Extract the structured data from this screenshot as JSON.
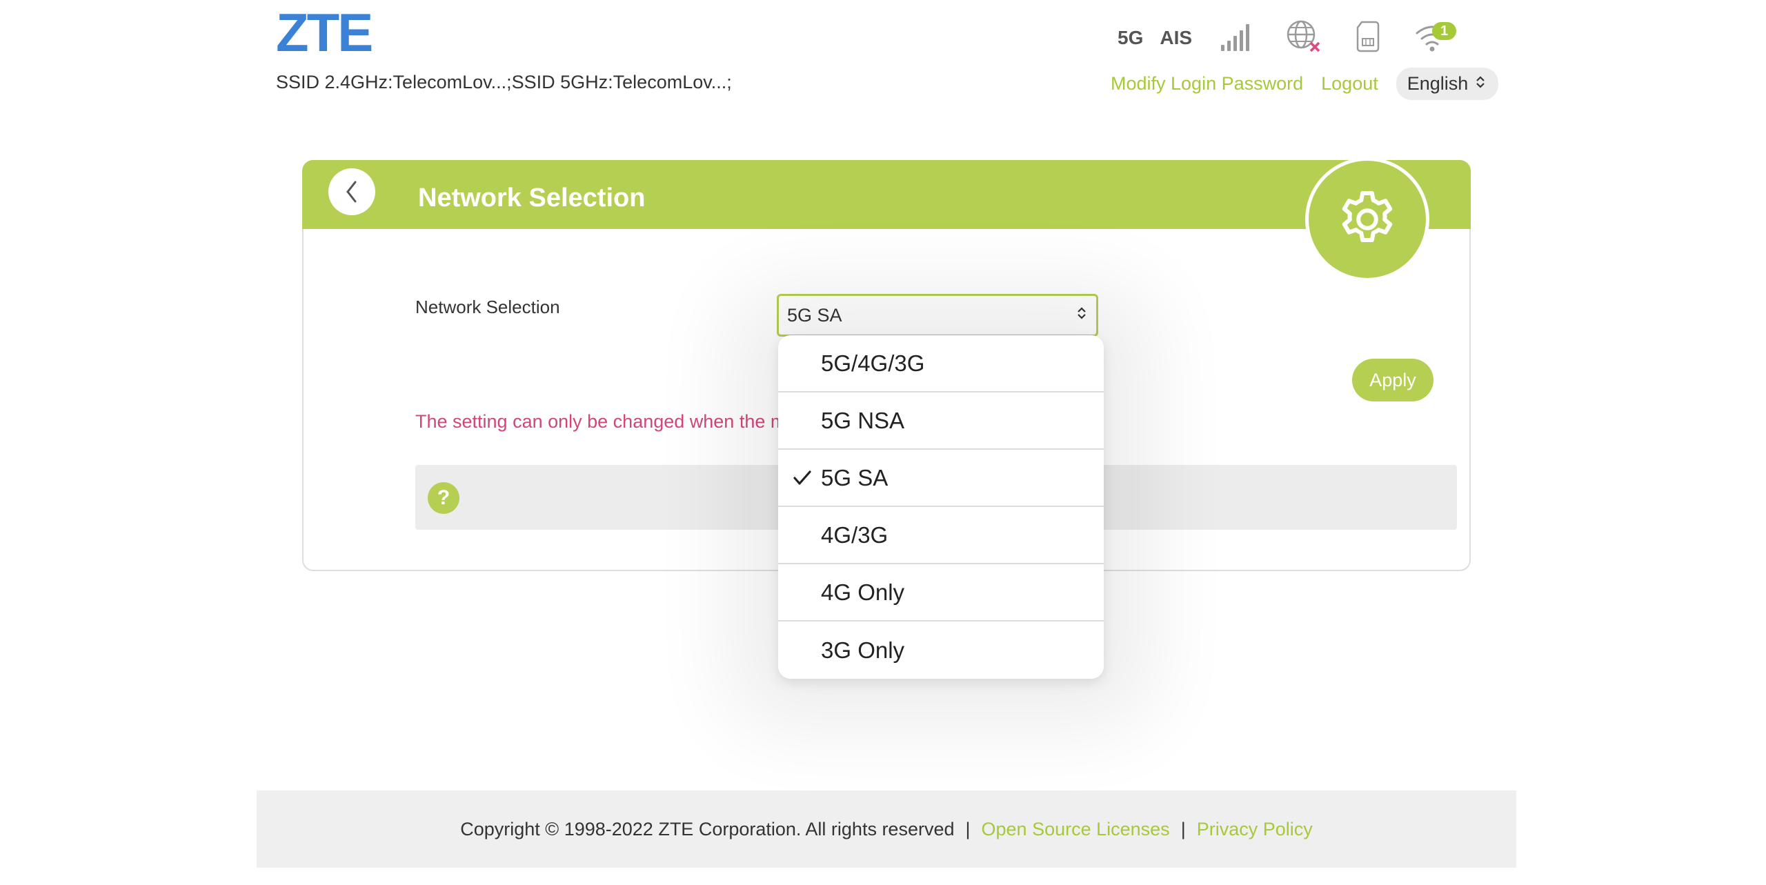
{
  "header": {
    "logo": "ZTE",
    "ssid": "SSID 2.4GHz:TelecomLov...;SSID 5GHz:TelecomLov...;",
    "status": {
      "network_generation": "5G",
      "operator": "AIS",
      "signal_icon": "signal-bars-icon",
      "internet_icon": "globe-disconnected-icon",
      "sim_icon": "sim-card-icon",
      "wifi_icon": "wifi-icon",
      "wifi_clients": "1"
    },
    "links": {
      "modify_password": "Modify Login Password",
      "logout": "Logout"
    },
    "language": {
      "selected": "English"
    }
  },
  "panel": {
    "title": "Network Selection",
    "back_icon": "chevron-left-icon",
    "section_icon": "gear-icon",
    "field_label": "Network Selection",
    "select_value": "5G SA",
    "apply_label": "Apply",
    "warning": "The setting can only be changed when the m",
    "help_icon": "?"
  },
  "dropdown": {
    "options": [
      {
        "label": "5G/4G/3G",
        "selected": false
      },
      {
        "label": "5G NSA",
        "selected": false
      },
      {
        "label": "5G SA",
        "selected": true
      },
      {
        "label": "4G/3G",
        "selected": false
      },
      {
        "label": "4G Only",
        "selected": false
      },
      {
        "label": "3G Only",
        "selected": false
      }
    ]
  },
  "footer": {
    "copyright": "Copyright © 1998-2022 ZTE Corporation. All rights reserved",
    "separator": "|",
    "open_source": "Open Source Licenses",
    "privacy": "Privacy Policy"
  },
  "colors": {
    "brand_green": "#b5cf52",
    "link_green": "#a6c938",
    "logo_blue": "#3b82d6",
    "warning_pink": "#d14679"
  }
}
